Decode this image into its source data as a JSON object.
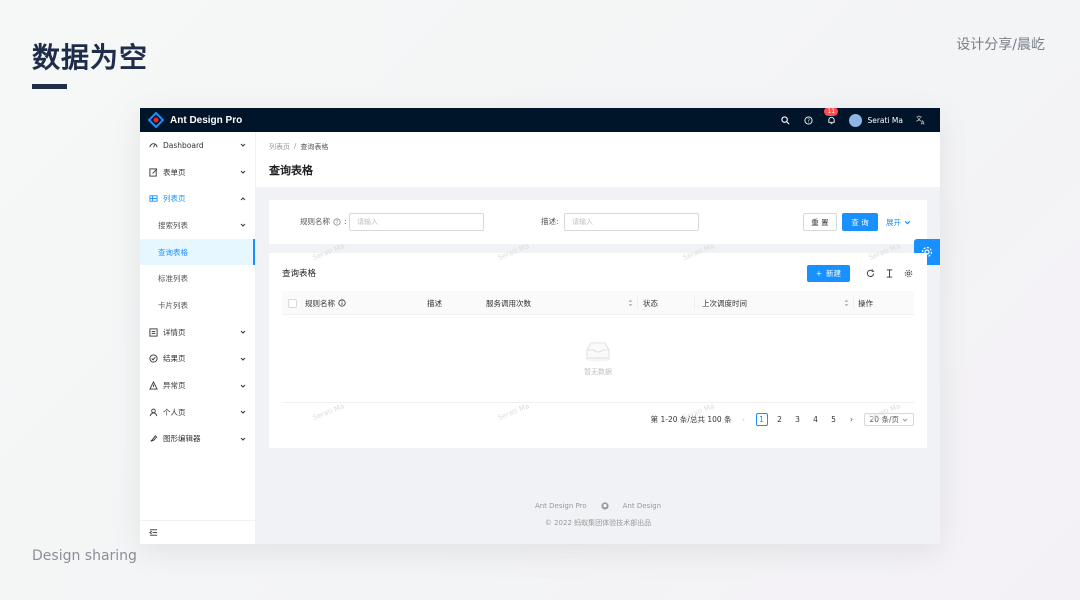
{
  "slide": {
    "title": "数据为空",
    "tag": "设计分享/晨屹",
    "footer": "Design sharing"
  },
  "app": {
    "brand": "Ant Design Pro",
    "notification_count": "11",
    "user_name": "Serati Ma"
  },
  "sidebar": {
    "items": [
      {
        "label": "Dashboard",
        "icon": "dashboard-icon"
      },
      {
        "label": "表单页",
        "icon": "form-icon"
      },
      {
        "label": "列表页",
        "icon": "table-icon"
      },
      {
        "label": "搜索列表"
      },
      {
        "label": "查询表格"
      },
      {
        "label": "标准列表"
      },
      {
        "label": "卡片列表"
      },
      {
        "label": "详情页",
        "icon": "profile-icon"
      },
      {
        "label": "结果页",
        "icon": "check-circle-icon"
      },
      {
        "label": "异常页",
        "icon": "warning-icon"
      },
      {
        "label": "个人页",
        "icon": "user-icon"
      },
      {
        "label": "图形编辑器",
        "icon": "highlight-icon"
      }
    ]
  },
  "header": {
    "breadcrumb": [
      "列表页",
      "查询表格"
    ],
    "title": "查询表格"
  },
  "search": {
    "rule_name_label": "规则名称",
    "rule_name_placeholder": "请输入",
    "desc_label": "描述",
    "desc_placeholder": "请输入",
    "reset_label": "重 置",
    "query_label": "查 询",
    "expand_label": "展开"
  },
  "table": {
    "title": "查询表格",
    "new_label": "新建",
    "columns": [
      "规则名称",
      "描述",
      "服务调用次数",
      "状态",
      "上次调度时间",
      "操作"
    ],
    "empty_text": "暂无数据"
  },
  "pagination": {
    "summary": "第 1-20 条/总共 100 条",
    "pages": [
      "1",
      "2",
      "3",
      "4",
      "5"
    ],
    "current": "1",
    "page_size": "20 条/页"
  },
  "footer": {
    "link1": "Ant Design Pro",
    "link2": "Ant Design",
    "copyright": "2022 蚂蚁集团体验技术部出品"
  },
  "watermark": "Serati Ma",
  "colors": {
    "primary": "#1890ff",
    "topbar": "#001529",
    "badge": "#ff4d4f"
  }
}
